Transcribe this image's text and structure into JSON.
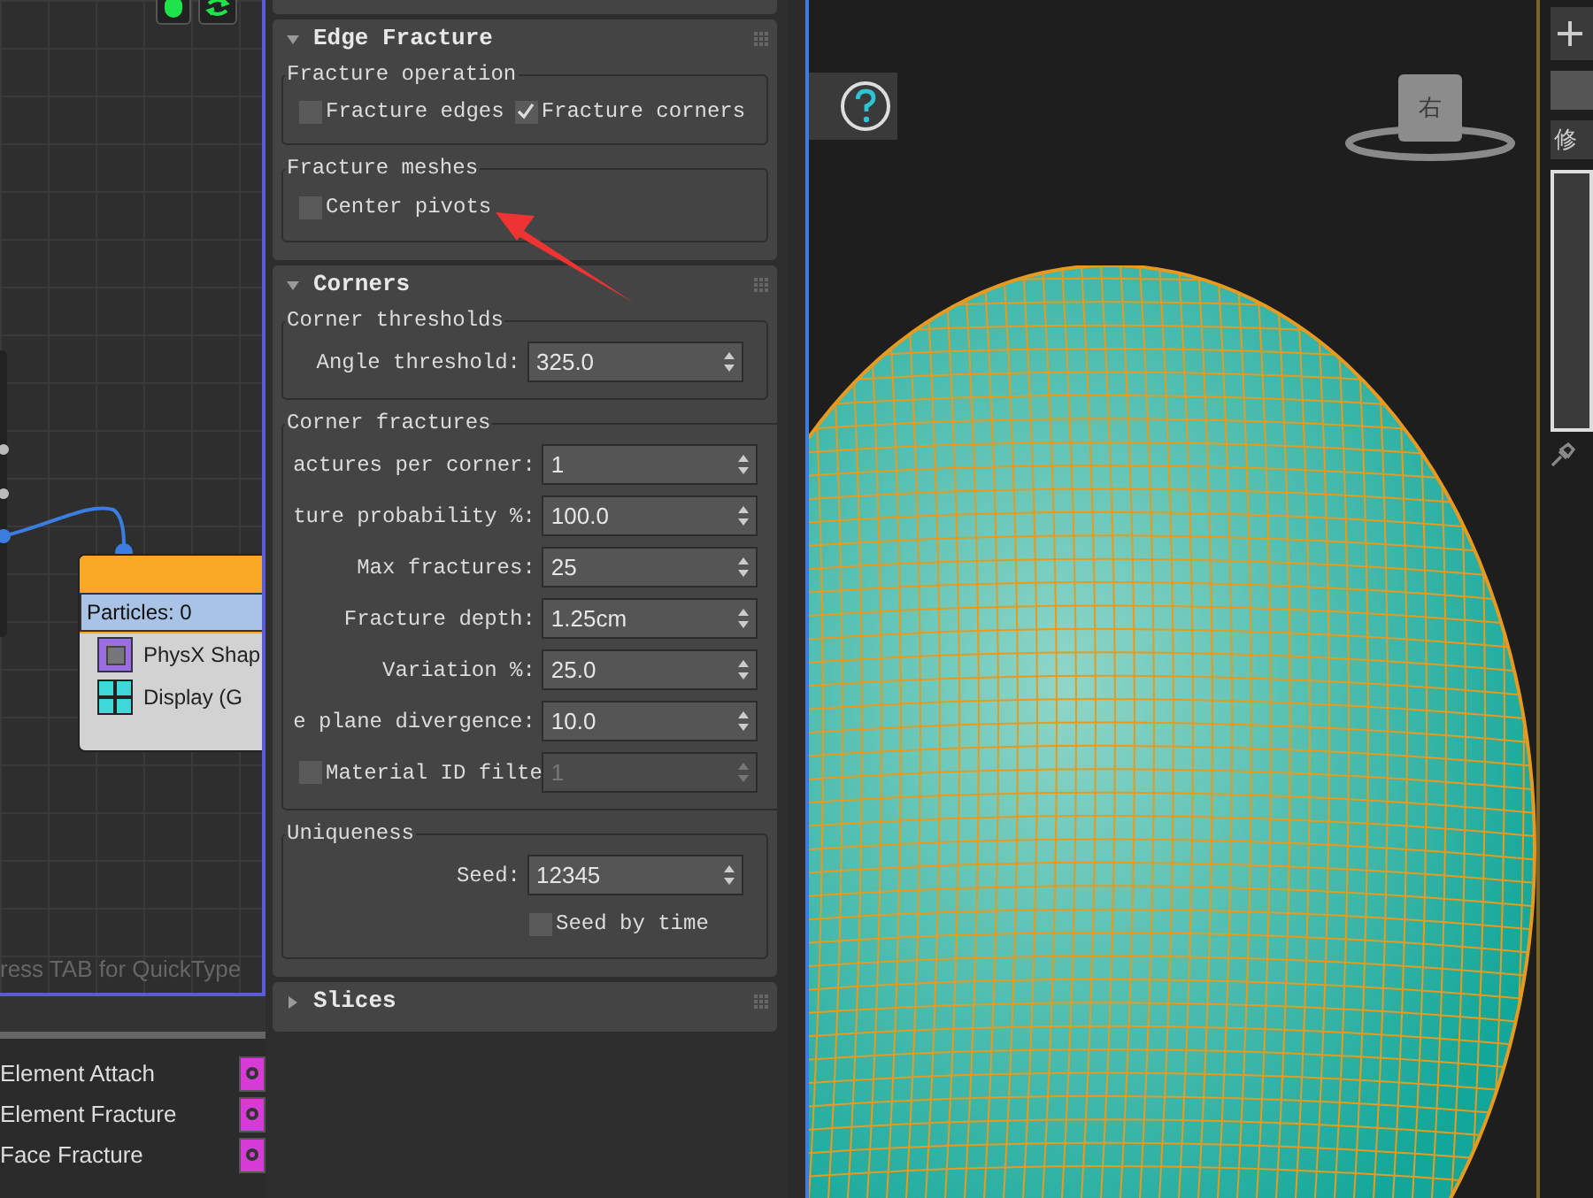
{
  "node_editor": {
    "node": {
      "header": "Particles: 0",
      "operators": [
        {
          "label": "PhysX Shap"
        },
        {
          "label": "Display (G"
        }
      ]
    },
    "hint": "ress TAB for QuickType"
  },
  "operator_list": [
    {
      "label": "Element Attach"
    },
    {
      "label": "Element Fracture"
    },
    {
      "label": "Face Fracture"
    }
  ],
  "rollouts": [
    {
      "title": "Edge Fracture",
      "expanded": true,
      "groups": [
        {
          "title": "Fracture operation",
          "rows": [
            {
              "kind": "checkboxes",
              "items": [
                {
                  "label": "Fracture edges",
                  "checked": false
                },
                {
                  "label": "Fracture corners",
                  "checked": true
                }
              ]
            }
          ]
        },
        {
          "title": "Fracture meshes",
          "rows": [
            {
              "kind": "checkbox",
              "label": "Center pivots",
              "checked": false
            }
          ]
        }
      ]
    },
    {
      "title": "Corners",
      "expanded": true,
      "groups": [
        {
          "title": "Corner thresholds",
          "rows": [
            {
              "kind": "spinner",
              "label": "Angle threshold:",
              "value": "325.0"
            }
          ]
        },
        {
          "title": "Corner fractures",
          "rows": [
            {
              "kind": "spinner",
              "label": "actures per corner:",
              "value": "1"
            },
            {
              "kind": "spinner",
              "label": "ture probability %:",
              "value": "100.0"
            },
            {
              "kind": "spinner",
              "label": "Max fractures:",
              "value": "25"
            },
            {
              "kind": "spinner",
              "label": "Fracture depth:",
              "value": "1.25cm"
            },
            {
              "kind": "spinner",
              "label": "Variation %:",
              "value": "25.0"
            },
            {
              "kind": "spinner",
              "label": "e plane divergence:",
              "value": "10.0"
            },
            {
              "kind": "check_spinner",
              "label": "Material ID filte",
              "checked": false,
              "value": "1",
              "disabled": true
            }
          ]
        },
        {
          "title": "Uniqueness",
          "rows": [
            {
              "kind": "spinner",
              "label": "Seed:",
              "value": "12345"
            },
            {
              "kind": "checkbox",
              "label": "Seed by time",
              "checked": false,
              "indent": true
            }
          ]
        }
      ]
    },
    {
      "title": "Slices",
      "expanded": false
    }
  ],
  "viewcube": {
    "face_label": "右"
  },
  "command_panel": {
    "tab_label": "修"
  }
}
